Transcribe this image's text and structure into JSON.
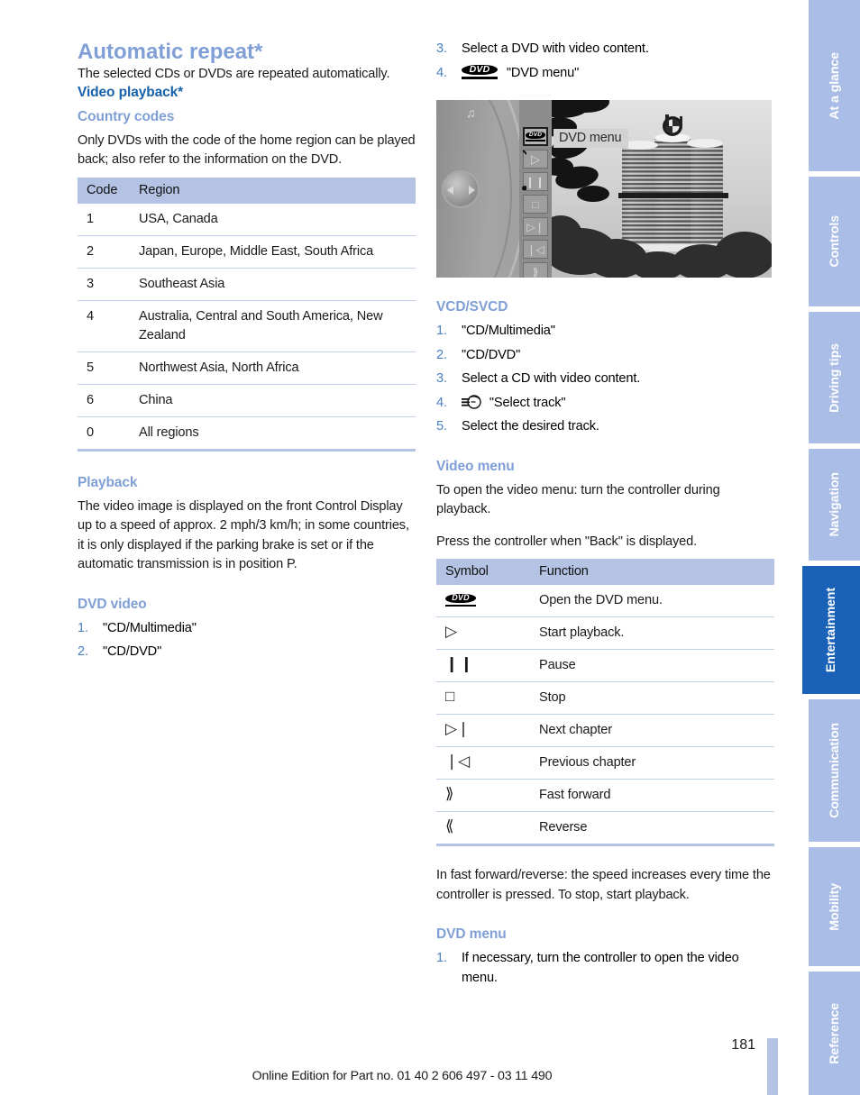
{
  "document": {
    "page_number": "181",
    "footer_note": "Online Edition for Part no. 01 40 2 606 497 - 03 11 490"
  },
  "sidebar": {
    "tabs": [
      {
        "label": "At a glance",
        "active": false
      },
      {
        "label": "Controls",
        "active": false
      },
      {
        "label": "Driving tips",
        "active": false
      },
      {
        "label": "Navigation",
        "active": false
      },
      {
        "label": "Entertainment",
        "active": true
      },
      {
        "label": "Communication",
        "active": false
      },
      {
        "label": "Mobility",
        "active": false
      },
      {
        "label": "Reference",
        "active": false
      }
    ],
    "active_color": "#1a62b8",
    "inactive_color": "#a9bde6"
  },
  "left_column": {
    "automatic_repeat": {
      "heading": "Automatic repeat*",
      "body": "The selected CDs or DVDs are repeated automatically."
    },
    "video_playback": {
      "heading": "Video playback*"
    },
    "country_codes": {
      "heading": "Country codes",
      "body": "Only DVDs with the code of the home region can be played back; also refer to the information on the DVD.",
      "table": {
        "headers": [
          "Code",
          "Region"
        ],
        "rows": [
          [
            "1",
            "USA, Canada"
          ],
          [
            "2",
            "Japan, Europe, Middle East, South Africa"
          ],
          [
            "3",
            "Southeast Asia"
          ],
          [
            "4",
            "Australia, Central and South America, New Zealand"
          ],
          [
            "5",
            "Northwest Asia, North Africa"
          ],
          [
            "6",
            "China"
          ],
          [
            "0",
            "All regions"
          ]
        ]
      }
    },
    "playback": {
      "heading": "Playback",
      "body": "The video image is displayed on the front Control Display up to a speed of approx. 2 mph/3 km/h; in some countries, it is only displayed if the parking brake is set or if the automatic transmission is in position P."
    },
    "dvd_video": {
      "heading": "DVD video",
      "steps": [
        {
          "num": "1.",
          "text": "\"CD/Multimedia\""
        },
        {
          "num": "2.",
          "text": "\"CD/DVD\""
        }
      ]
    }
  },
  "right_column": {
    "dvd_video_continued": {
      "steps": [
        {
          "num": "3.",
          "text": "Select a DVD with video content.",
          "icon": ""
        },
        {
          "num": "4.",
          "text": "\"DVD menu\"",
          "icon": "dvd-logo-icon"
        }
      ]
    },
    "figure": {
      "name": "control-display-dvd-menu-screenshot",
      "overlay_label": "DVD menu",
      "buttons": [
        "dvd-menu-icon",
        "play-icon",
        "pause-icon",
        "stop-icon",
        "next-chapter-icon",
        "previous-chapter-icon",
        "fast-forward-icon",
        "reverse-icon"
      ],
      "subject": "BMW Four-Cylinder headquarters tower"
    },
    "vcd_svcd": {
      "heading": "VCD/SVCD",
      "steps": [
        {
          "num": "1.",
          "text": "\"CD/Multimedia\"",
          "icon": ""
        },
        {
          "num": "2.",
          "text": "\"CD/DVD\"",
          "icon": ""
        },
        {
          "num": "3.",
          "text": "Select a CD with video content.",
          "icon": ""
        },
        {
          "num": "4.",
          "text": "\"Select track\"",
          "icon": "select-track-icon"
        },
        {
          "num": "5.",
          "text": "Select the desired track.",
          "icon": ""
        }
      ]
    },
    "video_menu": {
      "heading": "Video menu",
      "body1": "To open the video menu: turn the controller during playback.",
      "body2": "Press the controller when \"Back\" is displayed.",
      "table": {
        "headers": [
          "Symbol",
          "Function"
        ],
        "rows": [
          {
            "symbol": "dvd-logo-icon",
            "function": "Open the DVD menu."
          },
          {
            "symbol": "play-icon",
            "function": "Start playback."
          },
          {
            "symbol": "pause-icon",
            "function": "Pause"
          },
          {
            "symbol": "stop-icon",
            "function": "Stop"
          },
          {
            "symbol": "next-chapter-icon",
            "function": "Next chapter"
          },
          {
            "symbol": "previous-chapter-icon",
            "function": "Previous chapter"
          },
          {
            "symbol": "fast-forward-icon",
            "function": "Fast forward"
          },
          {
            "symbol": "reverse-icon",
            "function": "Reverse"
          }
        ]
      },
      "note": "In fast forward/reverse: the speed increases every time the controller is pressed. To stop, start playback."
    },
    "dvd_menu": {
      "heading": "DVD menu",
      "steps": [
        {
          "num": "1.",
          "text": "If necessary, turn the controller to open the video menu."
        }
      ]
    }
  }
}
